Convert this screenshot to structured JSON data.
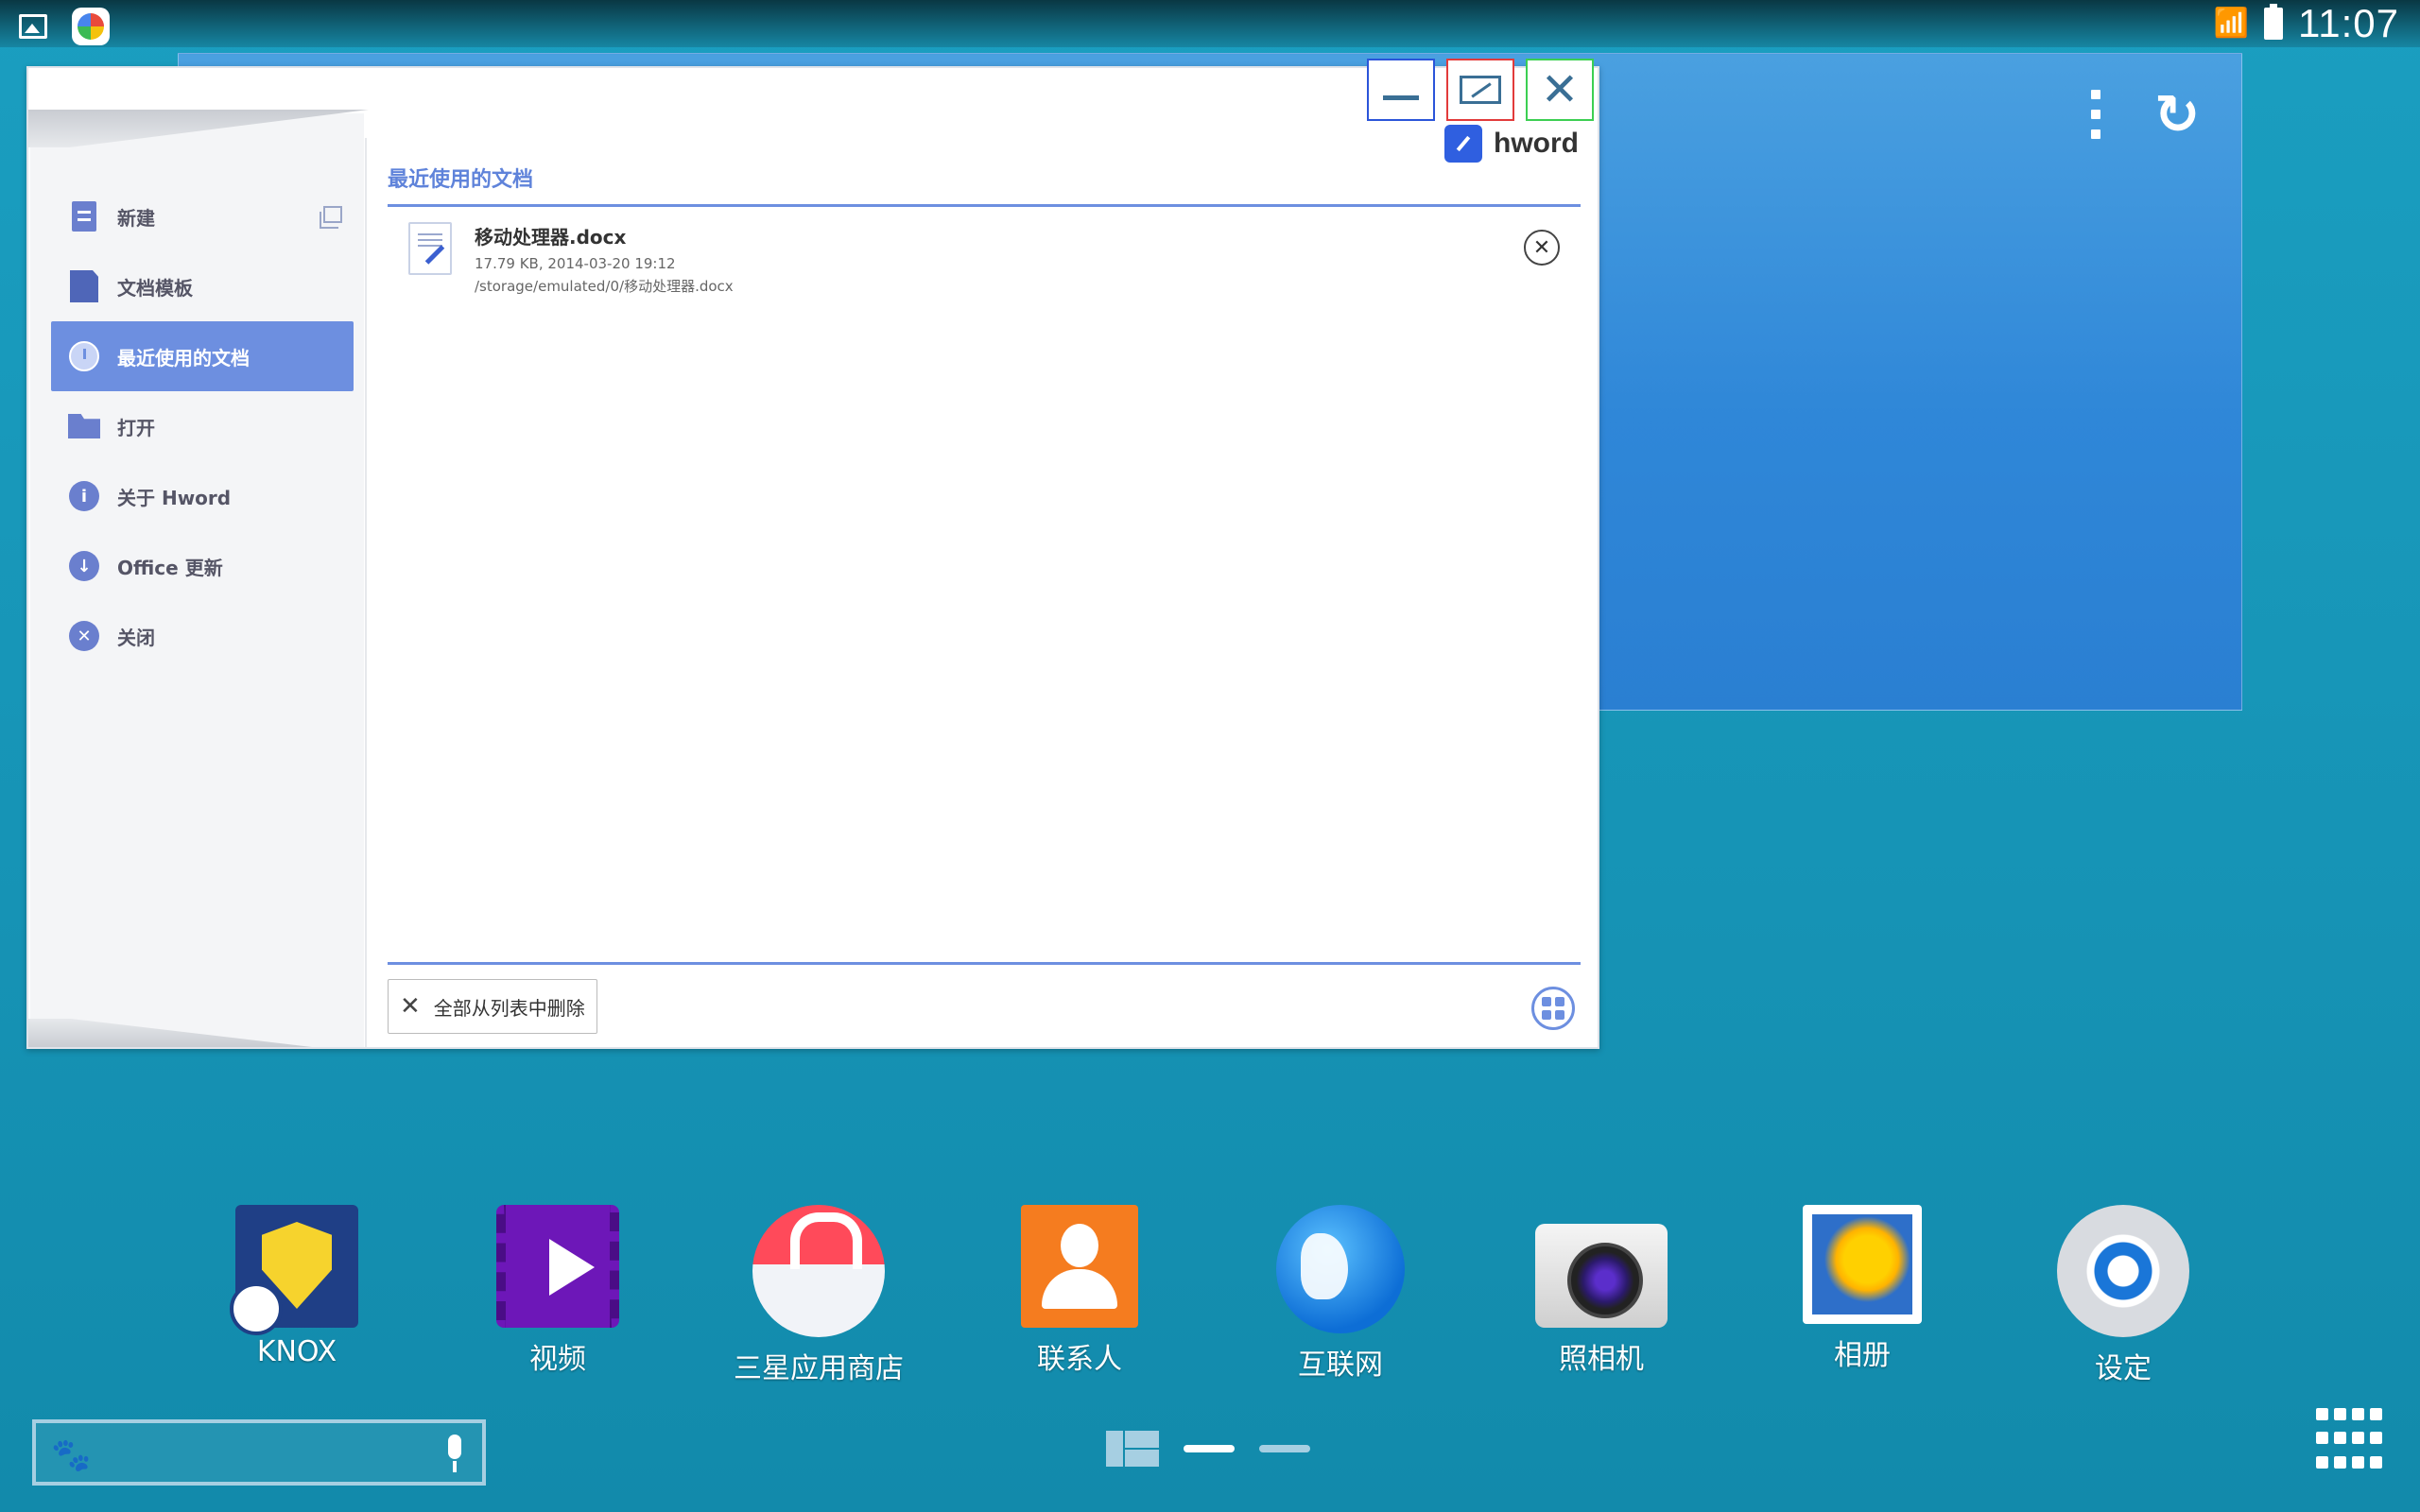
{
  "status_bar": {
    "time": "11:07",
    "icons": [
      "gallery-icon",
      "app-notification-icon",
      "wifi-icon",
      "battery-icon"
    ]
  },
  "window": {
    "brand_name": "hword",
    "controls": [
      "minimize",
      "maximize",
      "close"
    ],
    "sidebar": {
      "items": [
        {
          "label": "新建",
          "icon": "new-document-icon"
        },
        {
          "label": "文档模板",
          "icon": "template-icon"
        },
        {
          "label": "最近使用的文档",
          "icon": "clock-icon",
          "active": true
        },
        {
          "label": "打开",
          "icon": "folder-icon"
        },
        {
          "label": "关于 Hword",
          "icon": "info-icon"
        },
        {
          "label": "Office 更新",
          "icon": "download-icon"
        },
        {
          "label": "关闭",
          "icon": "close-circle-icon"
        }
      ]
    },
    "main": {
      "section_title": "最近使用的文档",
      "files": [
        {
          "name": "移动处理器.docx",
          "meta": "17.79 KB, 2014-03-20 19:12",
          "path": "/storage/emulated/0/移动处理器.docx"
        }
      ],
      "clear_all_label": "全部从列表中删除"
    }
  },
  "dock": {
    "apps": [
      {
        "label": "KNOX",
        "icon": "knox-icon"
      },
      {
        "label": "视频",
        "icon": "video-icon"
      },
      {
        "label": "三星应用商店",
        "icon": "store-icon"
      },
      {
        "label": "联系人",
        "icon": "contacts-icon"
      },
      {
        "label": "互联网",
        "icon": "internet-icon"
      },
      {
        "label": "照相机",
        "icon": "camera-icon"
      },
      {
        "label": "相册",
        "icon": "gallery-icon"
      },
      {
        "label": "设定",
        "icon": "settings-icon"
      }
    ]
  }
}
